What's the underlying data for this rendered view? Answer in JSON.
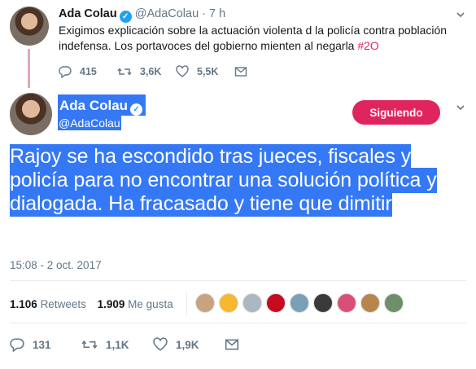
{
  "parent_tweet": {
    "name": "Ada Colau",
    "handle": "@AdaColau",
    "time": "· 7 h",
    "text": "Exigimos explicación sobre la actuación violenta d la policía contra población indefensa. Los portavoces del gobierno mienten al negarla ",
    "hashtag": "#2O",
    "actions": {
      "replies": "415",
      "retweets": "3,6K",
      "likes": "5,5K"
    }
  },
  "main_tweet": {
    "name": "Ada Colau",
    "handle": "@AdaColau",
    "follow_label": "Siguiendo",
    "text": "Rajoy se ha escondido tras jueces, fiscales y policía para no encontrar una solución política y dialogada. Ha fracasado y tiene que dimitir",
    "timestamp": "15:08 - 2 oct. 2017",
    "stats": {
      "retweets_count": "1.106",
      "retweets_label": "Retweets",
      "likes_count": "1.909",
      "likes_label": "Me gusta"
    },
    "liker_avatars": [
      {
        "color": "#c9a27f"
      },
      {
        "color": "#f5b82e"
      },
      {
        "color": "#aab8c2"
      },
      {
        "color": "#c60b1e"
      },
      {
        "color": "#7aa0b8"
      },
      {
        "color": "#3a3a3a"
      },
      {
        "color": "#d94f7a"
      },
      {
        "color": "#b8864d"
      },
      {
        "color": "#6d8f6a"
      }
    ],
    "actions": {
      "replies": "131",
      "retweets": "1,1K",
      "likes": "1,9K"
    }
  },
  "colors": {
    "accent": "#1da1f2",
    "follow": "#e0245e",
    "selection": "#3478f6",
    "muted": "#657786"
  }
}
